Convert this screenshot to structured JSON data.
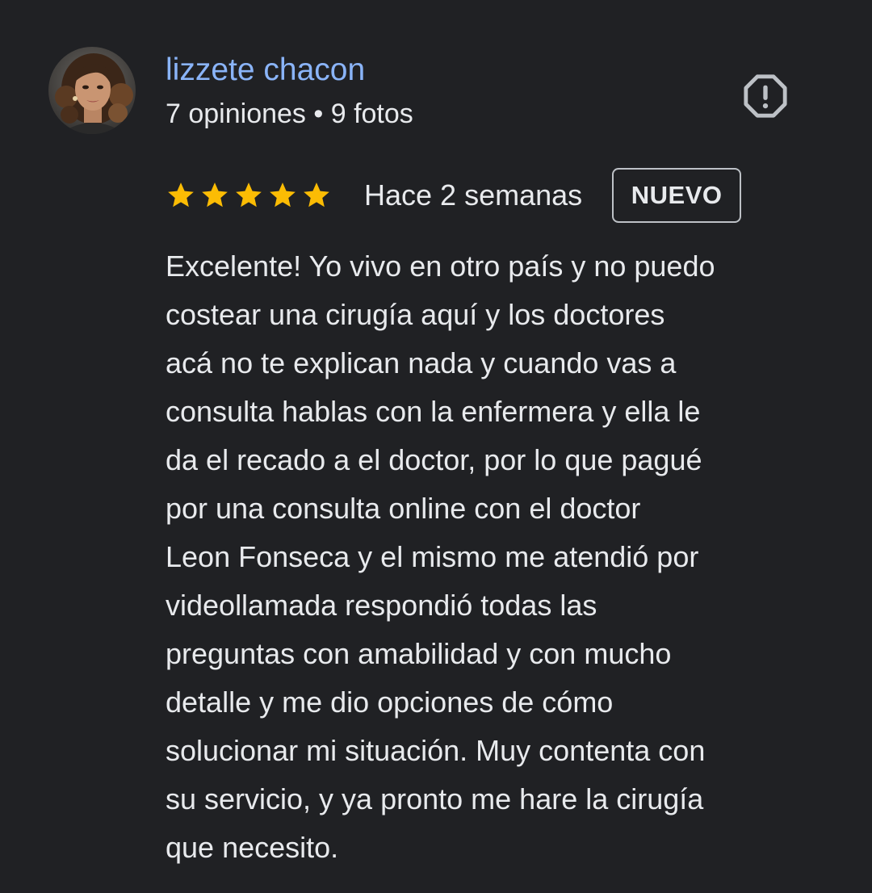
{
  "review": {
    "author": {
      "name": "lizzete chacon",
      "meta": "7 opiniones • 9 fotos",
      "avatar_icon": "user-photo-avatar"
    },
    "report_icon": "report-flag-icon",
    "rating": {
      "stars": 5,
      "max_stars": 5,
      "star_color": "#fbbc04"
    },
    "date": "Hace 2 semanas",
    "badge": "NUEVO",
    "text_lines": [
      "Excelente! Yo vivo en otro país y no puedo",
      "costear una cirugía aquí y los doctores",
      "acá no te explican nada y cuando vas a",
      "consulta hablas con la enfermera y ella le",
      "da el recado a el doctor, por lo que pagué",
      "por una consulta online con el doctor",
      "Leon Fonseca y el mismo me atendió por",
      "videollamada respondió todas las",
      "preguntas con amabilidad y con mucho",
      "detalle y me dio opciones de cómo",
      "solucionar mi situación. Muy contenta con",
      "su servicio, y ya pronto me hare la cirugía",
      "que necesito."
    ]
  },
  "colors": {
    "background": "#202124",
    "name_link": "#8ab4f8",
    "text": "#e8eaed",
    "icon_gray": "#bdc1c6",
    "star": "#fbbc04"
  }
}
